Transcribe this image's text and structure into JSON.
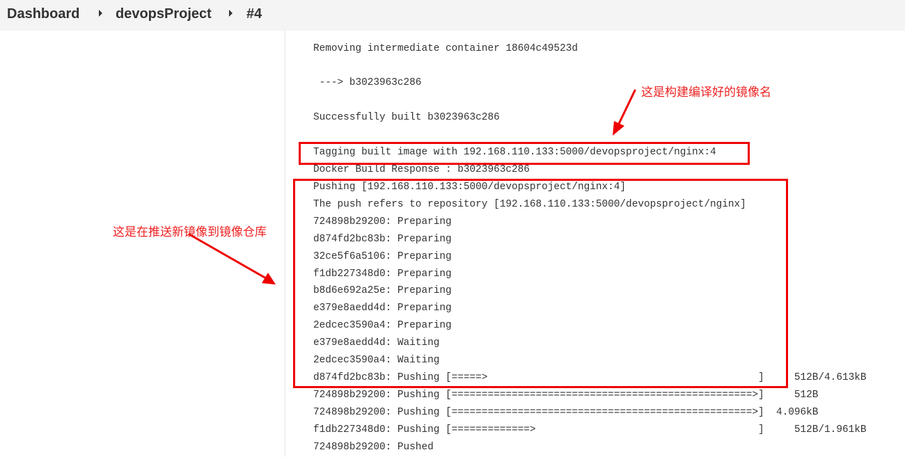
{
  "breadcrumb": {
    "items": [
      "Dashboard",
      "devopsProject",
      "#4"
    ]
  },
  "console": {
    "lines": [
      "Removing intermediate container 18604c49523d",
      " ---> b3023963c286",
      "Successfully built b3023963c286",
      "Tagging built image with 192.168.110.133:5000/devopsproject/nginx:4",
      "Docker Build Response : b3023963c286",
      "Pushing [192.168.110.133:5000/devopsproject/nginx:4]",
      "The push refers to repository [192.168.110.133:5000/devopsproject/nginx]",
      "724898b29200: Preparing",
      "d874fd2bc83b: Preparing",
      "32ce5f6a5106: Preparing",
      "f1db227348d0: Preparing",
      "b8d6e692a25e: Preparing",
      "e379e8aedd4d: Preparing",
      "2edcec3590a4: Preparing",
      "e379e8aedd4d: Waiting",
      "2edcec3590a4: Waiting",
      "d874fd2bc83b: Pushing [=====>                                             ]     512B/4.613kB",
      "724898b29200: Pushing [==================================================>]     512B",
      "724898b29200: Pushing [==================================================>]  4.096kB",
      "f1db227348d0: Pushing [=============>                                     ]     512B/1.961kB",
      "724898b29200: Pushed"
    ]
  },
  "annotations": {
    "image_name_note": "这是构建编译好的镜像名",
    "push_note": "这是在推送新镜像到镜像仓库"
  },
  "colors": {
    "annotation_red": "#ee0000",
    "breadcrumb_bar_bg": "#f4f4f4",
    "console_text": "#333333"
  }
}
